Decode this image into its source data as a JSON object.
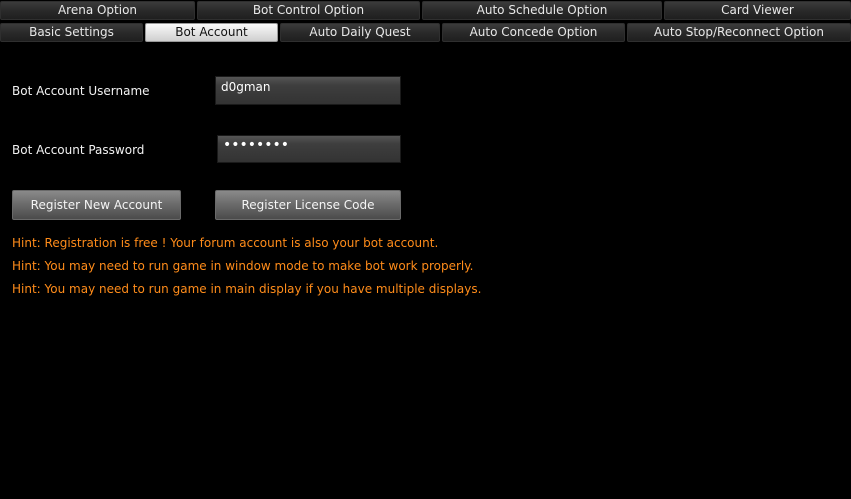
{
  "tabs": {
    "row1": [
      "Arena Option",
      "Bot Control Option",
      "Auto Schedule Option",
      "Card Viewer"
    ],
    "row2": [
      "Basic Settings",
      "Bot Account",
      "Auto Daily Quest",
      "Auto Concede Option",
      "Auto Stop/Reconnect Option"
    ],
    "selected": "Bot Account"
  },
  "account": {
    "username_label": "Bot Account Username",
    "username_value": "d0gman",
    "password_label": "Bot Account Password",
    "password_masked": "••••••••"
  },
  "buttons": {
    "register_account": "Register New Account",
    "register_license": "Register License Code"
  },
  "hints": [
    "Hint: Registration is free ! Your forum account is also your bot account.",
    "Hint: You may need to run game in window mode to make bot work properly.",
    "Hint: You may need to run game in main display if you have multiple displays."
  ],
  "colors": {
    "background": "#000000",
    "hint_text": "#ff8c1a",
    "selected_tab": "#e6e6e6"
  }
}
